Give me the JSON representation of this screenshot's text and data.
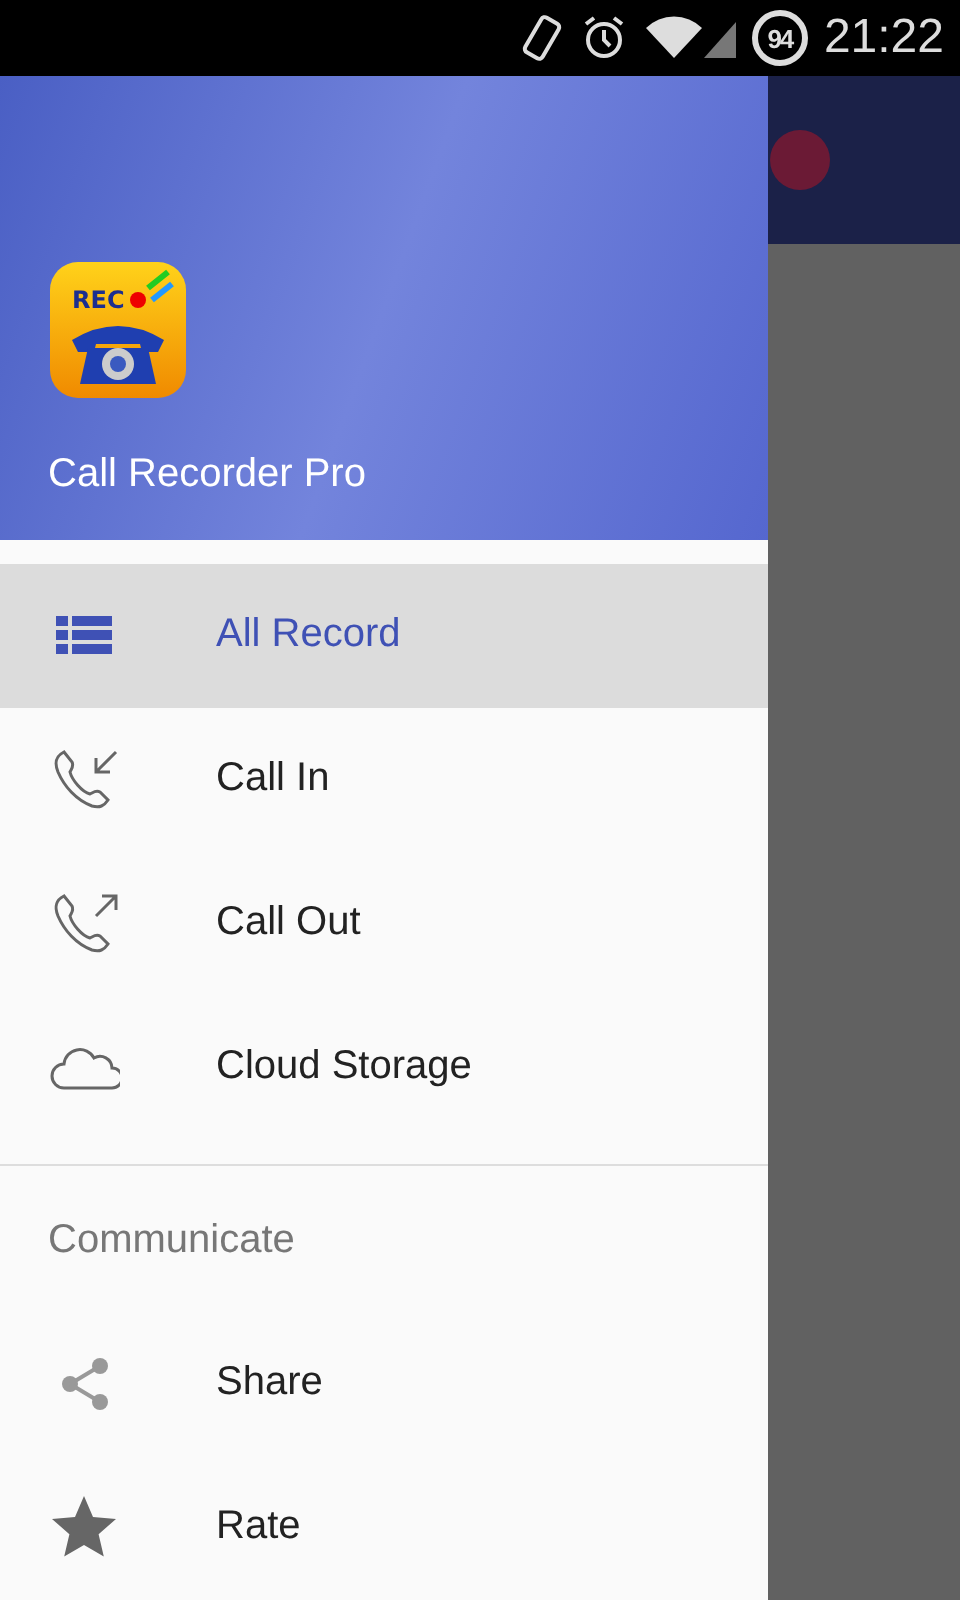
{
  "status_bar": {
    "battery": "94",
    "time": "21:22"
  },
  "drawer": {
    "app_name": "Call Recorder Pro",
    "logo_text": "REC",
    "items": [
      {
        "label": "All Record",
        "kind": "list",
        "selected": true
      },
      {
        "label": "Call In",
        "kind": "incoming",
        "selected": false
      },
      {
        "label": "Call Out",
        "kind": "outgoing",
        "selected": false
      },
      {
        "label": "Cloud Storage",
        "kind": "cloud",
        "selected": false
      }
    ],
    "section": "Communicate",
    "section_items": [
      {
        "label": "Share",
        "kind": "share",
        "selected": false
      },
      {
        "label": "Rate",
        "kind": "rate",
        "selected": false
      }
    ]
  }
}
